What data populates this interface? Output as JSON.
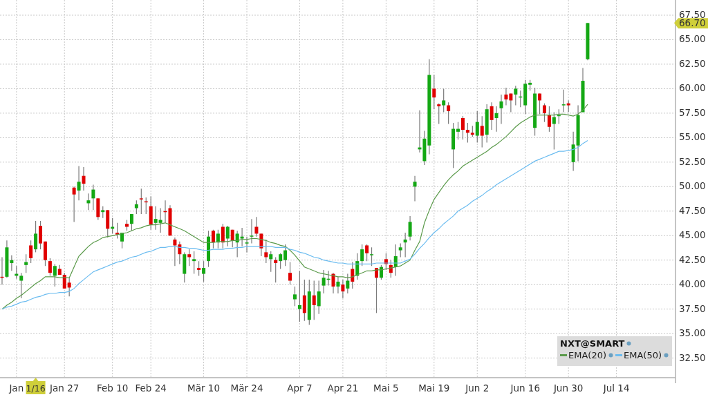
{
  "chart": {
    "chart_data": {
      "type": "candlestick",
      "title": "NXT@SMART",
      "grid": true,
      "legend": "lower right",
      "ylim": [
        30.5,
        69.05
      ],
      "categories": [
        null,
        null,
        null,
        "Jan",
        null,
        null,
        null,
        null,
        null,
        null,
        null,
        null,
        null,
        "Jan 27",
        null,
        null,
        null,
        null,
        null,
        null,
        null,
        null,
        null,
        "Feb 10",
        null,
        null,
        null,
        null,
        null,
        null,
        null,
        "Feb 24",
        null,
        null,
        null,
        null,
        null,
        null,
        null,
        null,
        null,
        null,
        "Mär 10",
        null,
        null,
        null,
        null,
        null,
        null,
        null,
        null,
        "Mär 24",
        null,
        null,
        null,
        null,
        null,
        null,
        null,
        null,
        null,
        null,
        "Apr 7",
        null,
        null,
        null,
        null,
        null,
        null,
        null,
        null,
        "Apr 21",
        null,
        null,
        null,
        null,
        null,
        null,
        null,
        null,
        "Mai 5",
        null,
        null,
        null,
        null,
        null,
        null,
        null,
        null,
        null,
        "Mai 19",
        null,
        null,
        null,
        null,
        null,
        null,
        null,
        null,
        "Jun 2",
        null,
        null,
        null,
        null,
        null,
        null,
        null,
        null,
        null,
        "Jun 16",
        null,
        null,
        null,
        null,
        null,
        null,
        null,
        null,
        "Jun 30",
        null,
        null,
        null,
        null,
        null,
        null,
        null,
        null,
        null,
        "Jul 14",
        null,
        null,
        null,
        null,
        null,
        null,
        null,
        null,
        null,
        null,
        null,
        null
      ],
      "yticks": [
        {
          "value": 32.5,
          "label": "32.50"
        },
        {
          "value": 35,
          "label": "35.00"
        },
        {
          "value": 37.5,
          "label": "37.50"
        },
        {
          "value": 40,
          "label": "40.00"
        },
        {
          "value": 42.5,
          "label": "42.50"
        },
        {
          "value": 45,
          "label": "45.00"
        },
        {
          "value": 47.5,
          "label": "47.50"
        },
        {
          "value": 50,
          "label": "50.00"
        },
        {
          "value": 52.5,
          "label": "52.50"
        },
        {
          "value": 55,
          "label": "55.00"
        },
        {
          "value": 57.5,
          "label": "57.50"
        },
        {
          "value": 60,
          "label": "60.00"
        },
        {
          "value": 62.5,
          "label": "62.50"
        },
        {
          "value": 65,
          "label": "65.00"
        },
        {
          "value": 67.5,
          "label": "67.50"
        }
      ],
      "ohlc": [
        [
          40.8,
          42.8,
          40.0,
          40.7
        ],
        [
          40.8,
          44.5,
          40.7,
          43.8
        ],
        [
          42.2,
          43.0,
          41.4,
          42.5
        ],
        [
          40.9,
          41.9,
          40.6,
          41.1
        ],
        [
          40.4,
          41.2,
          38.6,
          40.9
        ],
        [
          42.0,
          43.1,
          41.2,
          42.3
        ],
        [
          44.0,
          44.5,
          42.2,
          42.7
        ],
        [
          43.6,
          46.5,
          43.3,
          45.2
        ],
        [
          46.0,
          46.5,
          43.6,
          44.2
        ],
        [
          44.4,
          44.4,
          41.9,
          42.5
        ],
        [
          42.4,
          42.7,
          40.9,
          41.2
        ],
        [
          40.9,
          42.1,
          39.8,
          41.9
        ],
        [
          41.6,
          42.0,
          41.0,
          41.0
        ],
        [
          41.0,
          41.2,
          39.6,
          39.6
        ],
        [
          40.2,
          40.7,
          38.8,
          39.7
        ],
        [
          49.9,
          50.0,
          46.4,
          49.2
        ],
        [
          49.6,
          52.1,
          48.6,
          50.5
        ],
        [
          51.1,
          52.0,
          49.6,
          50.3
        ],
        [
          48.3,
          49.3,
          47.6,
          48.6
        ],
        [
          48.8,
          50.2,
          47.6,
          49.7
        ],
        [
          48.8,
          48.8,
          46.6,
          46.9
        ],
        [
          47.4,
          48.0,
          46.8,
          47.6
        ],
        [
          47.6,
          47.6,
          44.8,
          45.7
        ],
        [
          45.7,
          46.8,
          45.2,
          45.9
        ],
        [
          45.3,
          46.3,
          44.7,
          45.1
        ],
        [
          44.4,
          45.3,
          43.7,
          45.3
        ],
        [
          46.2,
          46.6,
          45.5,
          45.9
        ],
        [
          46.2,
          47.2,
          45.5,
          47.2
        ],
        [
          47.8,
          48.6,
          47.2,
          48.2
        ],
        [
          48.8,
          49.8,
          47.2,
          48.7
        ],
        [
          48.5,
          48.9,
          47.2,
          48.4
        ],
        [
          48.0,
          49.0,
          45.6,
          46.1
        ],
        [
          46.3,
          48.0,
          45.6,
          46.7
        ],
        [
          46.3,
          47.8,
          45.3,
          46.6
        ],
        [
          47.5,
          48.6,
          46.3,
          47.4
        ],
        [
          47.8,
          48.1,
          45.0,
          45.0
        ],
        [
          44.6,
          44.8,
          41.9,
          44.0
        ],
        [
          44.1,
          44.4,
          42.1,
          43.1
        ],
        [
          41.1,
          43.3,
          40.2,
          43.1
        ],
        [
          43.1,
          43.6,
          41.9,
          42.8
        ],
        [
          42.4,
          43.4,
          41.1,
          42.6
        ],
        [
          41.7,
          42.4,
          40.9,
          41.5
        ],
        [
          41.1,
          42.4,
          40.3,
          41.7
        ],
        [
          42.4,
          45.5,
          41.8,
          44.9
        ],
        [
          45.5,
          45.6,
          43.7,
          44.3
        ],
        [
          44.3,
          45.6,
          43.7,
          45.2
        ],
        [
          45.9,
          46.2,
          43.7,
          44.3
        ],
        [
          44.7,
          46.0,
          43.9,
          45.9
        ],
        [
          45.6,
          45.6,
          43.8,
          44.5
        ],
        [
          44.3,
          45.5,
          42.8,
          45.2
        ],
        [
          44.7,
          45.8,
          43.9,
          44.9
        ],
        [
          44.2,
          44.9,
          43.3,
          44.3
        ],
        [
          44.9,
          46.7,
          44.2,
          45.0
        ],
        [
          45.9,
          46.9,
          44.9,
          45.2
        ],
        [
          45.2,
          45.2,
          42.9,
          43.7
        ],
        [
          43.3,
          44.6,
          42.2,
          42.8
        ],
        [
          42.6,
          43.4,
          41.3,
          43.1
        ],
        [
          42.5,
          42.8,
          40.2,
          42.2
        ],
        [
          42.4,
          43.2,
          41.6,
          43.1
        ],
        [
          42.5,
          44.1,
          41.9,
          43.5
        ],
        [
          41.2,
          42.3,
          40.0,
          40.4
        ],
        [
          38.5,
          39.8,
          37.8,
          39.0
        ],
        [
          37.5,
          41.4,
          36.2,
          37.9
        ],
        [
          38.9,
          40.5,
          36.3,
          37.1
        ],
        [
          36.4,
          40.5,
          35.9,
          39.3
        ],
        [
          38.9,
          40.4,
          36.4,
          37.9
        ],
        [
          37.8,
          40.4,
          37.0,
          39.3
        ],
        [
          39.9,
          41.5,
          39.1,
          40.7
        ],
        [
          40.5,
          41.4,
          39.9,
          40.6
        ],
        [
          41.1,
          41.2,
          39.1,
          39.8
        ],
        [
          39.8,
          40.8,
          39.1,
          40.3
        ],
        [
          40.0,
          40.5,
          38.6,
          39.3
        ],
        [
          39.6,
          41.1,
          39.1,
          40.4
        ],
        [
          41.6,
          42.3,
          39.6,
          40.3
        ],
        [
          40.9,
          43.2,
          40.5,
          42.4
        ],
        [
          42.4,
          44.1,
          41.9,
          43.6
        ],
        [
          44.0,
          44.1,
          42.4,
          43.2
        ],
        [
          43.0,
          43.8,
          41.9,
          43.1
        ],
        [
          41.7,
          41.7,
          37.1,
          40.7
        ],
        [
          40.7,
          42.0,
          40.5,
          41.8
        ],
        [
          42.6,
          43.2,
          41.5,
          42.1
        ],
        [
          42.0,
          42.5,
          40.7,
          41.2
        ],
        [
          41.8,
          44.1,
          40.9,
          42.9
        ],
        [
          43.5,
          44.2,
          42.8,
          43.8
        ],
        [
          44.3,
          45.3,
          42.8,
          44.6
        ],
        [
          44.9,
          47.0,
          44.5,
          46.4
        ],
        [
          50.0,
          51.1,
          48.5,
          50.5
        ],
        [
          53.8,
          57.8,
          53.5,
          54.0
        ],
        [
          52.6,
          55.7,
          52.2,
          54.9
        ],
        [
          54.2,
          63.0,
          53.3,
          61.4
        ],
        [
          60.0,
          61.4,
          57.9,
          59.1
        ],
        [
          58.4,
          58.5,
          56.4,
          58.2
        ],
        [
          58.3,
          60.0,
          57.6,
          58.8
        ],
        [
          58.3,
          58.6,
          56.4,
          57.7
        ],
        [
          53.8,
          56.5,
          51.9,
          55.9
        ],
        [
          55.6,
          56.6,
          54.8,
          55.9
        ],
        [
          57.0,
          57.2,
          54.8,
          55.8
        ],
        [
          55.8,
          56.5,
          54.5,
          55.5
        ],
        [
          55.5,
          56.2,
          55.1,
          55.3
        ],
        [
          55.2,
          57.7,
          54.5,
          56.6
        ],
        [
          56.2,
          57.2,
          54.0,
          55.2
        ],
        [
          55.3,
          58.4,
          54.5,
          57.9
        ],
        [
          58.2,
          58.6,
          55.8,
          56.8
        ],
        [
          57.0,
          58.2,
          55.6,
          57.5
        ],
        [
          58.0,
          59.4,
          56.4,
          58.7
        ],
        [
          59.4,
          60.1,
          58.3,
          58.9
        ],
        [
          59.5,
          59.5,
          57.6,
          58.8
        ],
        [
          59.4,
          60.3,
          58.3,
          60.0
        ],
        [
          59.1,
          59.8,
          58.1,
          59.2
        ],
        [
          58.3,
          60.9,
          57.4,
          60.5
        ],
        [
          60.4,
          60.9,
          59.8,
          60.6
        ],
        [
          56.0,
          60.1,
          55.2,
          59.5
        ],
        [
          59.5,
          59.5,
          57.4,
          58.8
        ],
        [
          58.3,
          58.5,
          56.6,
          57.5
        ],
        [
          57.3,
          58.2,
          55.6,
          56.1
        ],
        [
          56.4,
          57.6,
          53.8,
          57.1
        ],
        [
          57.2,
          57.9,
          56.4,
          57.3
        ],
        [
          58.3,
          59.9,
          57.6,
          58.4
        ],
        [
          58.5,
          58.8,
          57.6,
          58.3
        ],
        [
          52.5,
          55.6,
          51.6,
          54.3
        ],
        [
          54.2,
          58.3,
          52.6,
          57.3
        ],
        [
          57.6,
          62.1,
          57.6,
          60.8
        ],
        [
          63.0,
          66.7,
          62.9,
          66.7
        ],
        null,
        null,
        null,
        null,
        null,
        null,
        null,
        null,
        null,
        null,
        null,
        null,
        null,
        null,
        null,
        null,
        null,
        null
      ],
      "series": [
        {
          "name": "EMA(20)",
          "type": "line",
          "color": "#5a9a4a",
          "values": [
            37.5,
            37.9,
            38.2,
            38.6,
            38.9,
            39.3,
            39.7,
            40.1,
            40.4,
            40.8,
            40.8,
            40.8,
            40.7,
            40.7,
            40.7,
            41.8,
            42.9,
            43.4,
            43.9,
            44.3,
            44.5,
            44.8,
            44.9,
            45.0,
            45.1,
            45.2,
            45.3,
            45.5,
            45.7,
            45.8,
            46.0,
            46.1,
            46.1,
            46.2,
            46.3,
            46.1,
            45.9,
            45.7,
            45.5,
            45.2,
            44.9,
            44.6,
            44.3,
            44.3,
            44.3,
            44.4,
            44.4,
            44.4,
            44.5,
            44.5,
            44.6,
            44.6,
            44.7,
            44.7,
            44.6,
            44.5,
            44.3,
            44.2,
            44.0,
            43.9,
            43.5,
            43.0,
            42.4,
            41.8,
            41.6,
            41.4,
            41.2,
            41.1,
            41.0,
            40.9,
            40.8,
            40.8,
            40.7,
            40.8,
            41.0,
            41.2,
            41.4,
            41.4,
            41.5,
            41.5,
            41.6,
            41.7,
            41.8,
            41.9,
            42.2,
            42.5,
            43.5,
            44.4,
            46.3,
            47.6,
            48.7,
            49.4,
            50.1,
            50.7,
            51.2,
            51.6,
            52.1,
            52.4,
            52.7,
            53.0,
            53.3,
            53.6,
            54.0,
            54.3,
            54.7,
            55.1,
            55.6,
            56.1,
            56.5,
            56.8,
            57.1,
            57.3,
            57.3,
            57.3,
            57.3,
            57.3,
            57.4,
            57.4,
            57.3,
            57.2,
            57.4,
            57.8,
            58.4,
            null,
            null,
            null,
            null,
            null,
            null,
            null,
            null,
            null,
            null,
            null,
            null,
            null,
            null,
            null,
            null,
            null,
            null
          ]
        },
        {
          "name": "EMA(50)",
          "type": "line",
          "color": "#6bbcf0",
          "values": [
            37.5,
            37.7,
            37.8,
            38.0,
            38.2,
            38.3,
            38.5,
            38.7,
            38.8,
            39.0,
            39.1,
            39.1,
            39.2,
            39.2,
            39.3,
            39.6,
            40.1,
            40.5,
            40.9,
            41.3,
            41.5,
            41.7,
            41.9,
            42.1,
            42.3,
            42.4,
            42.6,
            42.8,
            42.9,
            43.1,
            43.3,
            43.4,
            43.6,
            43.8,
            43.8,
            43.9,
            43.9,
            43.8,
            43.8,
            43.7,
            43.7,
            43.6,
            43.5,
            43.5,
            43.6,
            43.6,
            43.6,
            43.7,
            43.7,
            43.8,
            43.8,
            43.9,
            43.9,
            43.9,
            43.9,
            43.9,
            43.9,
            43.8,
            43.8,
            43.8,
            43.6,
            43.5,
            43.3,
            43.2,
            43.0,
            42.8,
            42.7,
            42.5,
            42.4,
            42.3,
            42.2,
            42.2,
            42.1,
            42.1,
            42.1,
            42.1,
            42.1,
            42.1,
            42.2,
            42.2,
            42.2,
            42.2,
            42.2,
            42.2,
            42.4,
            42.6,
            43.1,
            43.7,
            44.2,
            44.8,
            45.3,
            45.7,
            46.2,
            46.6,
            47.0,
            47.5,
            47.8,
            48.1,
            48.5,
            48.8,
            49.1,
            49.5,
            49.8,
            50.2,
            50.5,
            50.8,
            51.1,
            51.4,
            51.7,
            52.0,
            52.3,
            52.6,
            52.8,
            53.0,
            53.2,
            53.4,
            53.6,
            53.6,
            53.7,
            53.8,
            54.0,
            54.4,
            54.7,
            null,
            null,
            null,
            null,
            null,
            null,
            null,
            null,
            null,
            null,
            null,
            null,
            null,
            null,
            null,
            null,
            null,
            null
          ]
        }
      ],
      "annotations": [
        "66.70"
      ]
    },
    "cursor": {
      "label": "1/16"
    }
  }
}
